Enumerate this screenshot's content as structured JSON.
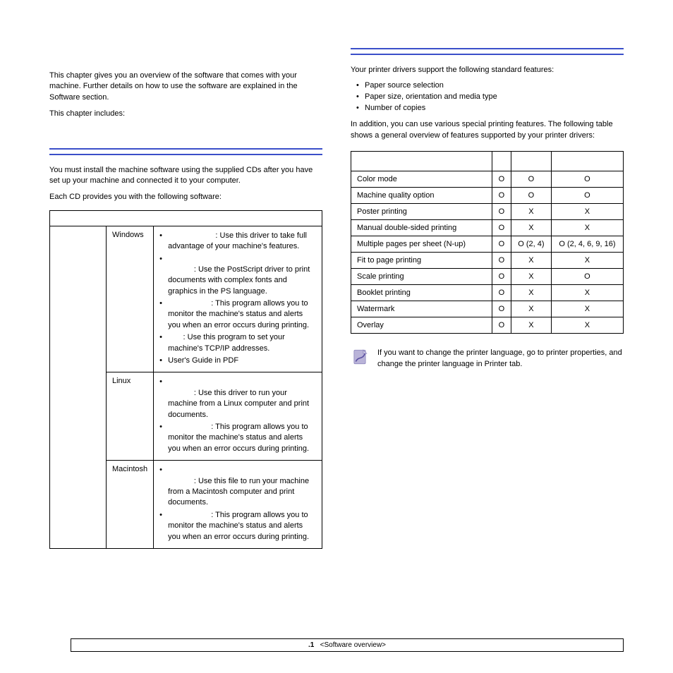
{
  "left": {
    "intro1": "This chapter gives you an overview of the software that comes with your machine. Further details on how to use the software are explained in the Software section.",
    "intro2": "This chapter includes:",
    "supplied_intro": "You must install the machine software using the supplied CDs after you have set up your machine and connected it to your computer.",
    "each_cd": "Each CD provides you with the following software:",
    "table": {
      "os1": "Windows",
      "os2": "Linux",
      "os3": "Macintosh",
      "win_b1": ": Use this driver to take full advantage of your machine's features.",
      "win_b2": ": Use the PostScript driver to print documents with complex fonts and graphics in the PS language.",
      "win_b3": ": This program allows you to monitor the machine's status and alerts you when an error occurs during printing.",
      "win_b4": ": Use this program to set your machine's TCP/IP addresses.",
      "win_b5": "User's Guide in PDF",
      "lin_b1": ": Use this driver to run your machine from a Linux computer and print documents.",
      "lin_b2": ": This program allows you to monitor the machine's status and alerts you when an error occurs during printing.",
      "mac_b1": ": Use this file to run your machine from a Macintosh computer and print documents.",
      "mac_b2": ": This program allows you to monitor the machine's status and alerts you when an error occurs during printing."
    }
  },
  "right": {
    "intro1": "Your printer drivers support the following standard features:",
    "bullets": {
      "b1": "Paper source selection",
      "b2": "Paper size, orientation and media type",
      "b3": "Number of copies"
    },
    "intro2": "In addition, you can use various special printing features. The following table shows a general overview of features supported by your printer drivers:",
    "features": [
      {
        "name": "Color mode",
        "c1": "O",
        "c2": "O",
        "c3": "O"
      },
      {
        "name": "Machine quality option",
        "c1": "O",
        "c2": "O",
        "c3": "O"
      },
      {
        "name": "Poster printing",
        "c1": "O",
        "c2": "X",
        "c3": "X"
      },
      {
        "name": "Manual double-sided printing",
        "c1": "O",
        "c2": "X",
        "c3": "X"
      },
      {
        "name": "Multiple pages per sheet (N-up)",
        "c1": "O",
        "c2": "O (2, 4)",
        "c3": "O (2, 4, 6, 9, 16)"
      },
      {
        "name": "Fit to page printing",
        "c1": "O",
        "c2": "X",
        "c3": "X"
      },
      {
        "name": "Scale printing",
        "c1": "O",
        "c2": "X",
        "c3": "O"
      },
      {
        "name": "Booklet printing",
        "c1": "O",
        "c2": "X",
        "c3": "X"
      },
      {
        "name": "Watermark",
        "c1": "O",
        "c2": "X",
        "c3": "X"
      },
      {
        "name": "Overlay",
        "c1": "O",
        "c2": "X",
        "c3": "X"
      }
    ],
    "note": "If you want to change the printer language, go to printer properties, and change the printer language in Printer tab."
  },
  "footer": {
    "page": ".1",
    "label": "<Software overview>"
  }
}
